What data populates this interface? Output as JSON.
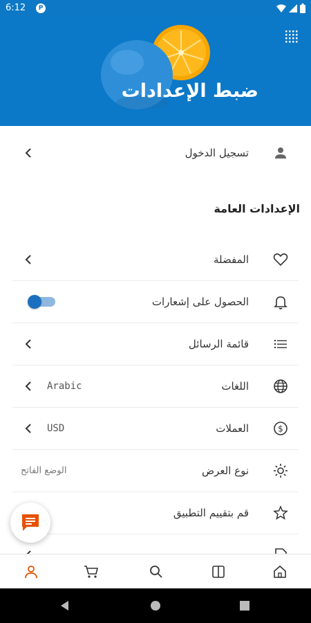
{
  "status_bar": {
    "time": "6:12",
    "app_icon": "P"
  },
  "header": {
    "title": "ضبط الإعدادات",
    "menu_icon": "grid-icon"
  },
  "login": {
    "label": "تسجيل الدخول",
    "icon": "user-icon"
  },
  "general_section": {
    "title": "الإعدادات العامة"
  },
  "settings": [
    {
      "label": "المفضلة",
      "icon": "heart-icon"
    },
    {
      "label": "الحصول على إشعارات",
      "icon": "bell-icon",
      "toggle_on": false
    },
    {
      "label": "قائمة الرسائل",
      "icon": "list-icon"
    },
    {
      "label": "اللغات",
      "icon": "globe-icon",
      "value": "Arabic"
    },
    {
      "label": "العملات",
      "icon": "dollar-icon",
      "value": "USD"
    },
    {
      "label": "نوع العرض",
      "icon": "sun-icon",
      "value": "الوضع الفاتح"
    },
    {
      "label": "قم بتقييم التطبيق",
      "icon": "star-icon"
    }
  ],
  "bottom_nav": [
    "profile-icon",
    "cart-icon",
    "search-icon",
    "categories-icon",
    "home-icon"
  ],
  "colors": {
    "header_bg": "#0b78c8",
    "accent_orange": "#e65100",
    "toggle": "#1a6fc0"
  }
}
